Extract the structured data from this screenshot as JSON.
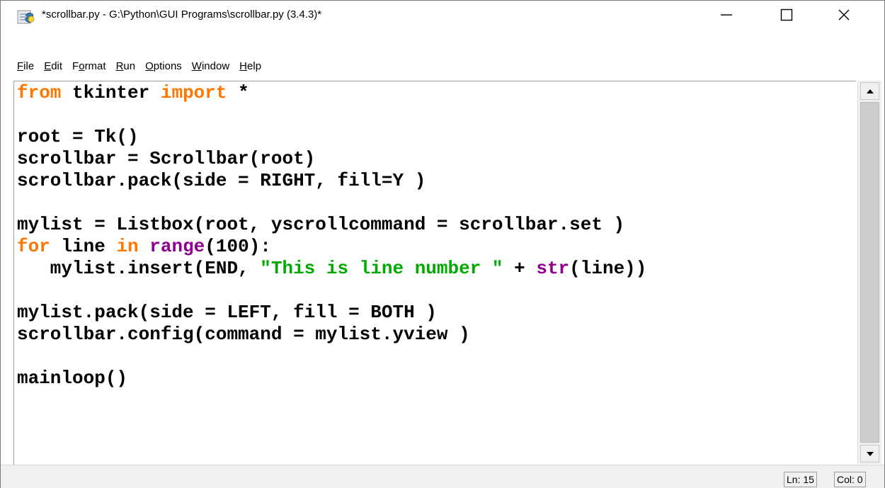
{
  "window": {
    "title": "*scrollbar.py - G:\\Python\\GUI Programs\\scrollbar.py (3.4.3)*"
  },
  "menu": [
    {
      "label": "File",
      "mnemonic": "F",
      "rest": "ile",
      "pre": ""
    },
    {
      "label": "Edit",
      "mnemonic": "E",
      "rest": "dit",
      "pre": ""
    },
    {
      "label": "Format",
      "mnemonic": "o",
      "rest": "rmat",
      "pre": "F"
    },
    {
      "label": "Run",
      "mnemonic": "R",
      "rest": "un",
      "pre": ""
    },
    {
      "label": "Options",
      "mnemonic": "O",
      "rest": "ptions",
      "pre": ""
    },
    {
      "label": "Window",
      "mnemonic": "W",
      "rest": "indow",
      "pre": ""
    },
    {
      "label": "Help",
      "mnemonic": "H",
      "rest": "elp",
      "pre": ""
    }
  ],
  "editor": {
    "lines": [
      "from tkinter import *",
      "",
      "root = Tk()",
      "scrollbar = Scrollbar(root)",
      "scrollbar.pack(side = RIGHT, fill=Y )",
      "",
      "mylist = Listbox(root, yscrollcommand = scrollbar.set )",
      "for line in range(100):",
      "   mylist.insert(END, \"This is line number \" + str(line))",
      "",
      "mylist.pack(side = LEFT, fill = BOTH )",
      "scrollbar.config(command = mylist.yview )",
      "",
      "mainloop()"
    ],
    "syntax_colors": {
      "keyword": "#ff7700",
      "builtin": "#900090",
      "string": "#00aa00",
      "default": "#000000"
    }
  },
  "status": {
    "line": "Ln: 15",
    "column": "Col: 0"
  },
  "icons": {
    "app": "python-idle-icon",
    "minimize": "minimize-icon",
    "maximize": "maximize-icon",
    "close": "close-icon",
    "scroll_up": "arrow-up-icon",
    "scroll_down": "arrow-down-icon"
  }
}
